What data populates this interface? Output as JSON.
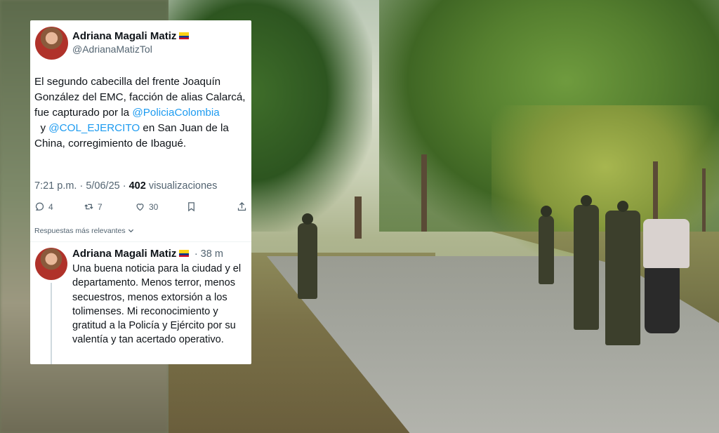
{
  "post": {
    "author_name": "Adriana Magali Matiz",
    "author_handle": "@AdrianaMatizTol",
    "text_parts": {
      "p1": "El segundo cabecilla del frente Joaquín González del EMC, facción de alias Calarcá, fue capturado por la ",
      "mention1": "@PoliciaColombia",
      "and": "  y ",
      "mention2": "@COL_EJERCITO",
      "p2": " en San Juan de la China, corregimiento de Ibagué."
    },
    "time": "7:21 p.m. · 5/06/25 · ",
    "views_count": "402",
    "views_label": " visualizaciones",
    "replies_count": "4",
    "reposts_count": "7",
    "likes_count": "30"
  },
  "replies_label": "Respuestas más relevantes",
  "reply": {
    "author_name": "Adriana Magali Matiz",
    "time": "· 38 m",
    "text": "Una buena noticia para la ciudad y el departamento. Menos terror, menos secuestros, menos extorsión a los tolimenses. Mi reconocimiento y gratitud a la Policía y Ejército por su valentía y tan acertado operativo."
  },
  "icons": [
    "reply-icon",
    "repost-icon",
    "like-icon",
    "bookmark-icon",
    "share-icon",
    "chevron-down-icon"
  ],
  "colors": {
    "link": "#1d9bf0",
    "muted": "#536471",
    "text": "#0f1419"
  }
}
